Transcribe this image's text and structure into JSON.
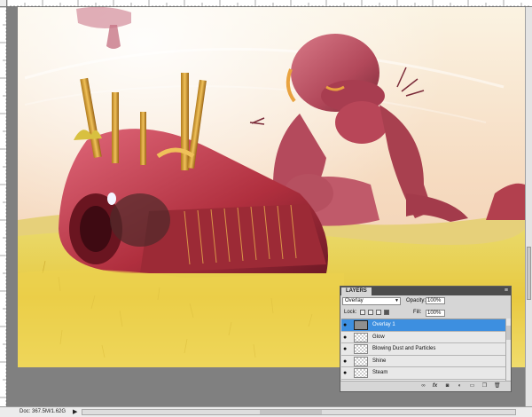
{
  "window": {
    "status_text": "Doc: 367.5M/1.62G",
    "status_arrow": "▶"
  },
  "layers_panel": {
    "tab_label": "LAYERS",
    "menu_icon": "≡",
    "blend_mode": "Overlay",
    "opacity_label": "Opacity:",
    "opacity_value": "100%",
    "lock_label": "Lock:",
    "fill_label": "Fill:",
    "fill_value": "100%",
    "layers": [
      {
        "name": "Overlay 1",
        "selected": true
      },
      {
        "name": "Glow",
        "selected": false
      },
      {
        "name": "Blowing Dust and Particles",
        "selected": false
      },
      {
        "name": "Shine",
        "selected": false
      },
      {
        "name": "Steam",
        "selected": false
      }
    ],
    "bottom_icons": [
      "link-icon",
      "fx-icon",
      "mask-icon",
      "adjustment-icon",
      "group-icon",
      "new-layer-icon",
      "trash-icon"
    ],
    "fx_glyph": "fx"
  },
  "colors": {
    "selection_blue": "#3d8fe0",
    "sky": "#f6e6c8",
    "grass": "#e8c94a",
    "robot_red": "#b8323c"
  }
}
